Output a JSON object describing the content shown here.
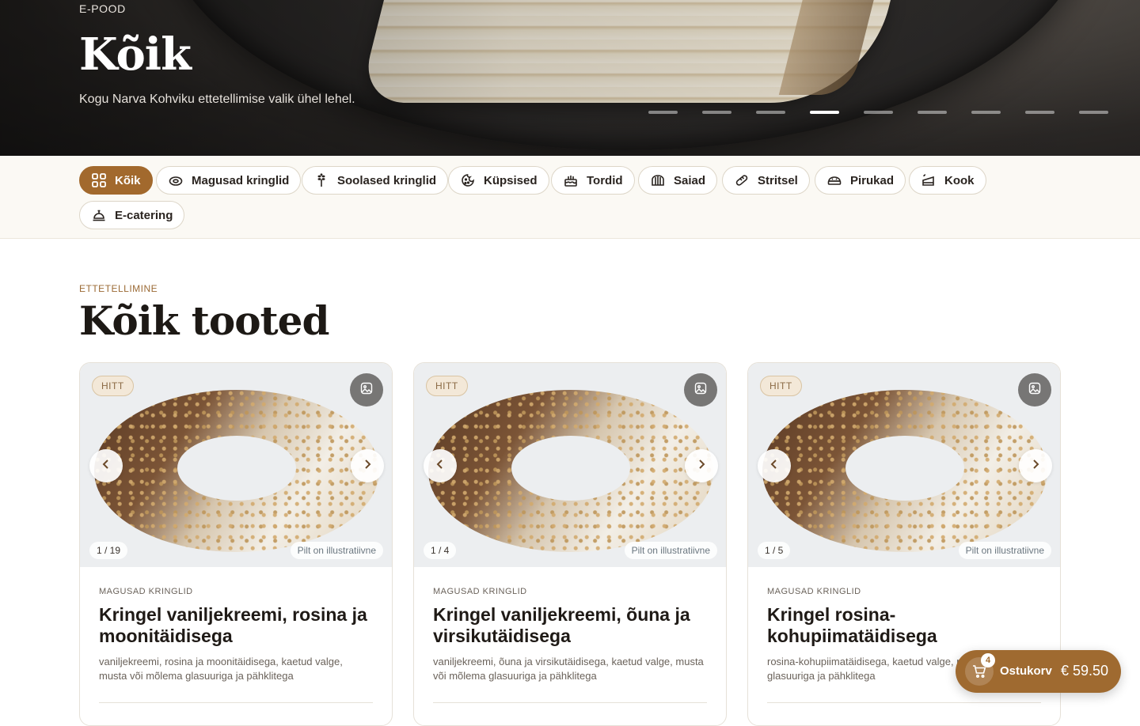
{
  "hero": {
    "eyebrow": "E-POOD",
    "title": "Kõik",
    "subtitle": "Kogu Narva Kohviku ettetellimise valik ühel lehel.",
    "slides": 9,
    "active_slide": 4
  },
  "categories": [
    {
      "label": "Kõik",
      "icon": "grid-icon",
      "active": true
    },
    {
      "label": "Magusad kringlid",
      "icon": "sweet-pretzel-icon",
      "active": false
    },
    {
      "label": "Soolased kringlid",
      "icon": "wheat-icon",
      "active": false
    },
    {
      "label": "Küpsised",
      "icon": "cookie-icon",
      "active": false
    },
    {
      "label": "Tordid",
      "icon": "cake-icon",
      "active": false
    },
    {
      "label": "Saiad",
      "icon": "bread-icon",
      "active": false
    },
    {
      "label": "Stritsel",
      "icon": "stritsel-icon",
      "active": false
    },
    {
      "label": "Pirukad",
      "icon": "pie-icon",
      "active": false
    },
    {
      "label": "Kook",
      "icon": "cake-slice-icon",
      "active": false
    },
    {
      "label": "E-catering",
      "icon": "cloche-icon",
      "active": false
    }
  ],
  "section": {
    "eyebrow": "ETTETELLIMINE",
    "title": "Kõik tooted"
  },
  "products": [
    {
      "badge": "HITT",
      "counter": "1 / 19",
      "illustrative": "Pilt on illustratiivne",
      "category": "MAGUSAD KRINGLID",
      "title": "Kringel vaniljekreemi, rosina ja moonitäidisega",
      "description": "vaniljekreemi, rosina ja moonitäidisega, kaetud valge, musta või mõlema glasuuriga ja pähklitega"
    },
    {
      "badge": "HITT",
      "counter": "1 / 4",
      "illustrative": "Pilt on illustratiivne",
      "category": "MAGUSAD KRINGLID",
      "title": "Kringel vaniljekreemi, õuna ja virsikutäidisega",
      "description": "vaniljekreemi, õuna ja virsikutäidisega, kaetud valge, musta või mõlema glasuuriga ja pähklitega"
    },
    {
      "badge": "HITT",
      "counter": "1 / 5",
      "illustrative": "Pilt on illustratiivne",
      "category": "MAGUSAD KRINGLID",
      "title": "Kringel rosina-kohupiimatäidisega",
      "description": "rosina-kohupiimatäidisega, kaetud valge, musta või mõlema glasuuriga ja pähklitega"
    }
  ],
  "cart": {
    "label": "Ostukorv",
    "count": "4",
    "total": "€ 59.50"
  },
  "colors": {
    "accent": "#a2692d",
    "cart": "#9f6a30",
    "eyebrow": "#9b6a35"
  }
}
